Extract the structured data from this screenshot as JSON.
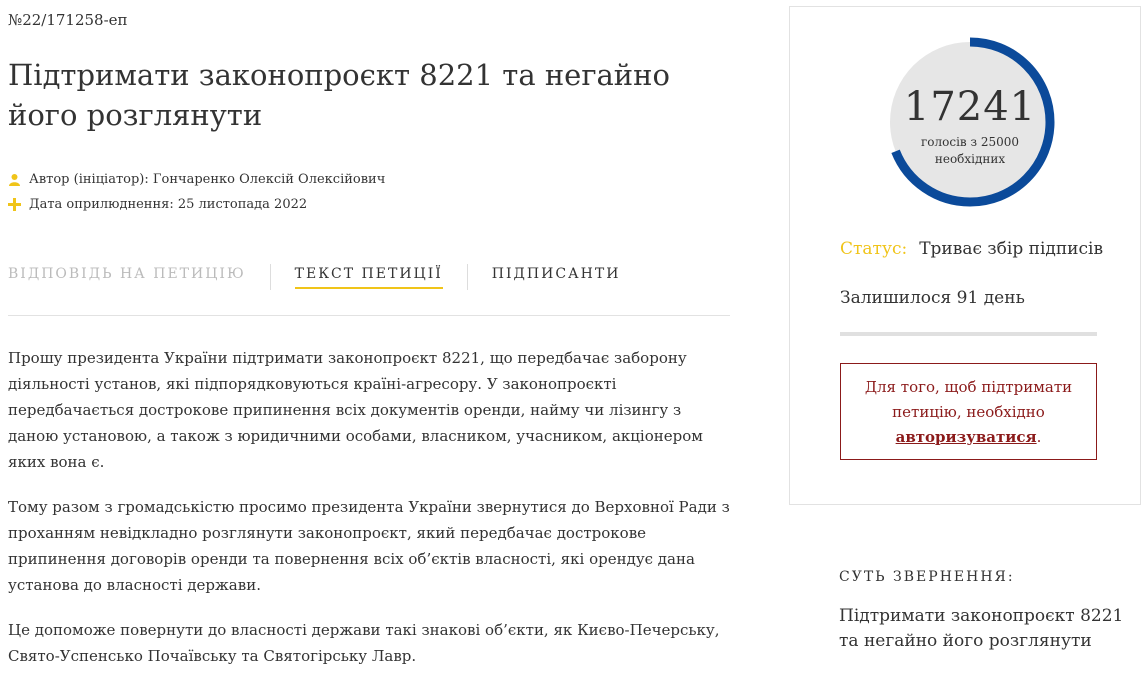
{
  "petition": {
    "number": "№22/171258-еп",
    "title": "Підтримати законопроєкт 8221 та негайно його розглянути",
    "author": "Автор (ініціатор): Гончаренко Олексій Олексійович",
    "date": "Дата оприлюднення: 25 листопада 2022"
  },
  "tabs": {
    "answer": "ВІДПОВІДЬ НА ПЕТИЦІЮ",
    "text": "ТЕКСТ ПЕТИЦІЇ",
    "signers": "ПІДПИСАНТИ"
  },
  "body": {
    "p1": "Прошу президента України підтримати законопроєкт 8221, що передбачає заборону діяльності установ, які підпорядковуються країні-агресору. У законопроєкті передбачається дострокове припинення всіх документів оренди, найму чи лізингу з даною установою, а також з юридичними особами, власником, учасником, акціонером яких вона є.",
    "p2": "Тому разом з громадськістю просимо президента України звернутися до Верховної Ради з проханням невідкладно розглянути законопроєкт, який передбачає дострокове припинення договорів оренди та повернення всіх об’єктів власності, які орендує дана установа до власності держави.",
    "p3": "Це допоможе повернути до власності держави такі знакові об’єкти, як Києво-Печерську, Свято-Успенсько Почаївську та Святогірську Лавр."
  },
  "sidebar": {
    "votes": "17241",
    "votes_sub_1": "голосів з 25000",
    "votes_sub_2": "необхідних",
    "votes_needed": 25000,
    "progress_fraction": 0.69,
    "status_label": "Статус:",
    "status_value": "Триває збір підписів",
    "remaining": "Залишилося 91 день",
    "auth_text_1": "Для того, щоб підтримати",
    "auth_text_2": "петицію, необхідно",
    "auth_link": "авторизуватися",
    "auth_dot": ".",
    "essence_heading": "СУТЬ ЗВЕРНЕННЯ:",
    "essence_text": "Підтримати законопроєкт 8221 та негайно його розглянути"
  },
  "colors": {
    "accent_blue": "#0b4a9a",
    "accent_yellow": "#f0c419",
    "alert_red": "#8b1a1a"
  }
}
